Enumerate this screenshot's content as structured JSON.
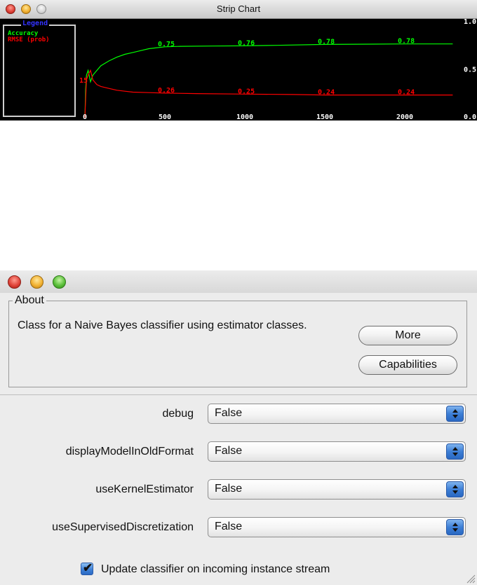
{
  "strip_chart": {
    "title": "Strip Chart",
    "legend": {
      "title": "Legend",
      "items": [
        {
          "label": "Accuracy",
          "color": "#00ff00"
        },
        {
          "label": "RMSE (prob)",
          "color": "#ff0000"
        }
      ]
    }
  },
  "chart_data": {
    "type": "line",
    "xlim": [
      0,
      2320
    ],
    "ylim": [
      0,
      1.0
    ],
    "x_ticks": [
      0,
      500,
      1000,
      1500,
      2000
    ],
    "x_tick_labels": [
      "0",
      "500",
      "1000",
      "1500",
      "2000"
    ],
    "y_ticks": [
      1.0,
      0.5,
      0.0
    ],
    "y_tick_labels": [
      "1.0",
      "0.5",
      "0.0"
    ],
    "grid": false,
    "legend_position": "left",
    "series": [
      {
        "name": "Accuracy",
        "color": "#00ff00",
        "x": [
          0,
          5,
          10,
          20,
          35,
          50,
          75,
          100,
          150,
          200,
          250,
          300,
          350,
          400,
          450,
          500,
          600,
          800,
          1000,
          1200,
          1500,
          1800,
          2000,
          2300
        ],
        "y": [
          0.0,
          0.3,
          0.45,
          0.5,
          0.38,
          0.45,
          0.5,
          0.55,
          0.6,
          0.64,
          0.67,
          0.69,
          0.71,
          0.73,
          0.74,
          0.75,
          0.755,
          0.758,
          0.76,
          0.765,
          0.775,
          0.778,
          0.78,
          0.78
        ],
        "point_labels": [
          {
            "x": 500,
            "text": "0.75"
          },
          {
            "x": 1000,
            "text": "0.76"
          },
          {
            "x": 1500,
            "text": "0.78"
          },
          {
            "x": 2000,
            "text": "0.78"
          }
        ]
      },
      {
        "name": "RMSE (prob)",
        "color": "#ff0000",
        "x": [
          0,
          5,
          10,
          20,
          35,
          50,
          75,
          100,
          150,
          200,
          250,
          300,
          400,
          500,
          700,
          1000,
          1300,
          1500,
          2000,
          2300
        ],
        "y": [
          0.0,
          0.2,
          0.4,
          0.45,
          0.5,
          0.4,
          0.35,
          0.33,
          0.31,
          0.29,
          0.28,
          0.27,
          0.265,
          0.26,
          0.255,
          0.25,
          0.245,
          0.24,
          0.24,
          0.24
        ],
        "point_labels": [
          {
            "x": 500,
            "text": "0.26"
          },
          {
            "x": 1000,
            "text": "0.25"
          },
          {
            "x": 1500,
            "text": "0.24"
          },
          {
            "x": 2000,
            "text": "0.24"
          }
        ]
      }
    ],
    "start_label": "15"
  },
  "classifier_window": {
    "about": {
      "legend": "About",
      "description": "Class for a Naive Bayes classifier using estimator classes.",
      "more_button": "More",
      "capabilities_button": "Capabilities"
    },
    "properties": [
      {
        "label": "debug",
        "value": "False"
      },
      {
        "label": "displayModelInOldFormat",
        "value": "False"
      },
      {
        "label": "useKernelEstimator",
        "value": "False"
      },
      {
        "label": "useSupervisedDiscretization",
        "value": "False"
      }
    ],
    "update_checkbox": {
      "label": "Update classifier on incoming instance stream",
      "checked": true
    },
    "icons": {
      "checkmark": "check-icon",
      "resize": "resize-grip-icon",
      "arrows": "up-down-arrows-icon"
    }
  }
}
